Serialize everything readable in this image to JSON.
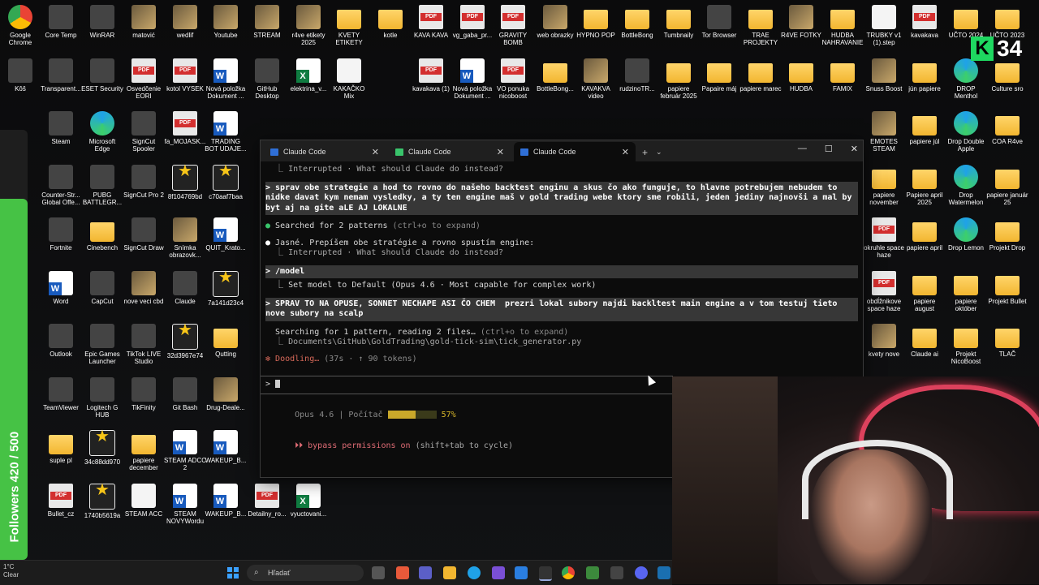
{
  "desktop_icons": [
    {
      "label": "Google Chrome",
      "type": "chrome"
    },
    {
      "label": "Core Temp",
      "type": "app"
    },
    {
      "label": "WinRAR",
      "type": "app"
    },
    {
      "label": "matović",
      "type": "img"
    },
    {
      "label": "wedlif",
      "type": "img"
    },
    {
      "label": "Youtube",
      "type": "img"
    },
    {
      "label": "STREAM",
      "type": "img"
    },
    {
      "label": "r4ve etikety 2025",
      "type": "img"
    },
    {
      "label": "KVETY ETIKETY",
      "type": "folder"
    },
    {
      "label": "kotle",
      "type": "folder"
    },
    {
      "label": "KAVA KAVA",
      "type": "pdf"
    },
    {
      "label": "vg_gaba_pr...",
      "type": "pdf"
    },
    {
      "label": "GRAVITY BOMB",
      "type": "pdf"
    },
    {
      "label": "web obrazky",
      "type": "img"
    },
    {
      "label": "HYPNO POP",
      "type": "folder"
    },
    {
      "label": "BottleBong",
      "type": "folder"
    },
    {
      "label": "Tumbnaily",
      "type": "folder"
    },
    {
      "label": "Tor Browser",
      "type": "app"
    },
    {
      "label": "TRAE PROJEKTY",
      "type": "folder"
    },
    {
      "label": "R4VE FOTKY",
      "type": "img"
    },
    {
      "label": "HUDBA NAHRAVANIE",
      "type": "folder"
    },
    {
      "label": "TRUBKY v1 (1).step",
      "type": "doc"
    },
    {
      "label": "kavakava",
      "type": "pdf"
    },
    {
      "label": "UČTO 2024",
      "type": "folder"
    },
    {
      "label": "UČTO 2023",
      "type": "folder"
    },
    {
      "label": "Kôš",
      "type": "app"
    },
    {
      "label": "Transparent...",
      "type": "app"
    },
    {
      "label": "ESET Security",
      "type": "app"
    },
    {
      "label": "Osvedčenie EORI",
      "type": "pdf"
    },
    {
      "label": "kotol VYSEK",
      "type": "pdf"
    },
    {
      "label": "Nová položka Dokument ...",
      "type": "word"
    },
    {
      "label": "GitHub Desktop",
      "type": "app"
    },
    {
      "label": "elektrina_v...",
      "type": "excel"
    },
    {
      "label": "KAKAČKO Mix",
      "type": "doc"
    },
    {
      "label": "kavakava (1)",
      "type": "pdf"
    },
    {
      "label": "Nová položka Dokument ...",
      "type": "word"
    },
    {
      "label": "VO ponuka nicoboost",
      "type": "pdf"
    },
    {
      "label": "BottleBong...",
      "type": "folder"
    },
    {
      "label": "KAVAKVA video",
      "type": "img"
    },
    {
      "label": "rudzinoTR...",
      "type": "app"
    },
    {
      "label": "papiere február 2025",
      "type": "folder"
    },
    {
      "label": "Papaire máj",
      "type": "folder"
    },
    {
      "label": "papiere marec",
      "type": "folder"
    },
    {
      "label": "HUDBA",
      "type": "folder"
    },
    {
      "label": "FAMIX",
      "type": "folder"
    },
    {
      "label": "Snuss Boost",
      "type": "img"
    },
    {
      "label": "jún papiere",
      "type": "folder"
    },
    {
      "label": "DROP Menthol",
      "type": "edge"
    },
    {
      "label": "Culture sro",
      "type": "folder"
    },
    {
      "label": "Steam",
      "type": "app"
    },
    {
      "label": "Microsoft Edge",
      "type": "edge"
    },
    {
      "label": "SignCut Spooler",
      "type": "app"
    },
    {
      "label": "fa_MOJASK...",
      "type": "pdf"
    },
    {
      "label": "TRADING BOT UDAJE...",
      "type": "word"
    },
    {
      "label": "EMOTES STEAM",
      "type": "img"
    },
    {
      "label": "papiere júl",
      "type": "folder"
    },
    {
      "label": "Drop Double Apple",
      "type": "edge"
    },
    {
      "label": "COA R4ve",
      "type": "folder"
    },
    {
      "label": "Counter-Str... Global Offe...",
      "type": "app"
    },
    {
      "label": "PUBG BATTLEGR...",
      "type": "app"
    },
    {
      "label": "SignCut Pro 2",
      "type": "app"
    },
    {
      "label": "8f104769bd",
      "type": "star"
    },
    {
      "label": "c70aaf7baa",
      "type": "star"
    },
    {
      "label": "papiere november",
      "type": "folder"
    },
    {
      "label": "Papiere april 2025",
      "type": "folder"
    },
    {
      "label": "Drop Watermelon",
      "type": "edge"
    },
    {
      "label": "papiere január 25",
      "type": "folder"
    },
    {
      "label": "Fortnite",
      "type": "app"
    },
    {
      "label": "Cinebench",
      "type": "folder"
    },
    {
      "label": "SignCut Draw",
      "type": "app"
    },
    {
      "label": "Snímka obrazovk...",
      "type": "img"
    },
    {
      "label": "QUIT_Krato...",
      "type": "word"
    },
    {
      "label": "okruhle space haze",
      "type": "pdf"
    },
    {
      "label": "papiere april",
      "type": "folder"
    },
    {
      "label": "Drop Lemon",
      "type": "edge"
    },
    {
      "label": "Projekt Drop",
      "type": "folder"
    },
    {
      "label": "Word",
      "type": "word"
    },
    {
      "label": "CapCut",
      "type": "app"
    },
    {
      "label": "nove veci cbd",
      "type": "img"
    },
    {
      "label": "Claude",
      "type": "app"
    },
    {
      "label": "7a141d23c4",
      "type": "star"
    },
    {
      "label": "obdĺžnikove space haze",
      "type": "pdf"
    },
    {
      "label": "papiere august",
      "type": "folder"
    },
    {
      "label": "papiere október",
      "type": "folder"
    },
    {
      "label": "Projekt Bullet",
      "type": "folder"
    },
    {
      "label": "Outlook",
      "type": "app"
    },
    {
      "label": "Epic Games Launcher",
      "type": "app"
    },
    {
      "label": "TikTok LIVE Studio",
      "type": "app"
    },
    {
      "label": "32d3967e74",
      "type": "star"
    },
    {
      "label": "Qutting",
      "type": "folder"
    },
    {
      "label": "kvety nove",
      "type": "img"
    },
    {
      "label": "Claude ai",
      "type": "folder"
    },
    {
      "label": "Projekt NicoBoost",
      "type": "folder"
    },
    {
      "label": "TLAČ",
      "type": "folder"
    },
    {
      "label": "TeamViewer",
      "type": "app"
    },
    {
      "label": "Logitech G HUB",
      "type": "app"
    },
    {
      "label": "TikFinity",
      "type": "app"
    },
    {
      "label": "Git Bash",
      "type": "app"
    },
    {
      "label": "Drug-Deale...",
      "type": "img"
    },
    {
      "label": "suple pl",
      "type": "folder"
    },
    {
      "label": "34c88dd970",
      "type": "star"
    },
    {
      "label": "papiere december",
      "type": "folder"
    },
    {
      "label": "STEAM ADCC 2",
      "type": "word"
    },
    {
      "label": "WAKEUP_B...",
      "type": "word"
    },
    {
      "label": "Bullet_cz",
      "type": "pdf"
    },
    {
      "label": "1740b5619a",
      "type": "star"
    },
    {
      "label": "STEAM ACC",
      "type": "doc"
    },
    {
      "label": "STEAM NOVYWordu",
      "type": "word"
    },
    {
      "label": "WAKEUP_B...",
      "type": "word"
    },
    {
      "label": "Detailny_ro...",
      "type": "pdf"
    },
    {
      "label": "vyuctovani...",
      "type": "excel"
    }
  ],
  "followers": {
    "label": "Followers 420 / 500",
    "current": 420,
    "goal": 500
  },
  "badge": {
    "letter": "K",
    "number": "34",
    "color": "#1ed760"
  },
  "terminal": {
    "tabs": [
      {
        "label": "Claude Code",
        "icon": "terminal-icon",
        "active": false
      },
      {
        "label": "Claude Code",
        "icon": "sheet-icon",
        "active": false
      },
      {
        "label": "Claude Code",
        "icon": "terminal-icon",
        "active": true
      }
    ],
    "new_tab": "+",
    "dropdown": "⌄",
    "controls": {
      "minimize": "—",
      "maximize": "☐",
      "close": "✕"
    },
    "lines": {
      "l1": "  ⎿ Interrupted · What should Claude do instead?",
      "l2": "> sprav obe strategie a hod to rovno do našeho backtest enginu a skus čo ako funguje, to hlavne potrebujem nebudem to nidke davat kym nemam vysledky, a ty ten engine maš v gold trading webe ktory sme robili, jeden jediny najnovši a mal by byt aj na gite aLE AJ LOKALNE",
      "l3_bullet": "●",
      "l3": " Searched for 2 patterns ",
      "l3_hint": "(ctrl+o to expand)",
      "l4_bullet": "●",
      "l4": " Jasné. Prepíšem obe stratégie a rovno spustím engine:",
      "l5": "  ⎿ Interrupted · What should Claude do instead?",
      "l6": "> /model",
      "l7": "  ⎿ Set model to Default (Opus 4.6 · Most capable for complex work)",
      "l8": "> SPRAV TO NA OPUSE, SONNET NECHAPE ASI ČO CHEM  prezri lokal subory najdi backltest main engine a v tom testuj tieto nove subory na scalp",
      "l9": "  Searching for 1 pattern, reading 2 files… ",
      "l9_hint": "(ctrl+o to expand)",
      "l10": "  ⎿ Documents\\GitHub\\GoldTrading\\gold-tick-sim\\tick_generator.py",
      "l11_star": "✻",
      "l11": " Doodling… ",
      "l11_meta": "(37s · ↑ 90 tokens)",
      "prompt": "> "
    },
    "status": {
      "model": "Opus 4.6",
      "sep": " | ",
      "context_label": "Počítač ",
      "context_percent": "57%",
      "context_value": 0.57,
      "bypass": "⏵⏵ bypass permissions on",
      "bypass_hint": " (shift+tab to cycle)"
    }
  },
  "taskbar": {
    "weather_temp": "1°C",
    "weather_desc": "Clear",
    "search_placeholder": "Hľadať"
  },
  "colors": {
    "accent_green": "#39c46b",
    "doodle": "#d86a5a",
    "progress": "#c9a82a",
    "bypass": "#e06c75"
  }
}
